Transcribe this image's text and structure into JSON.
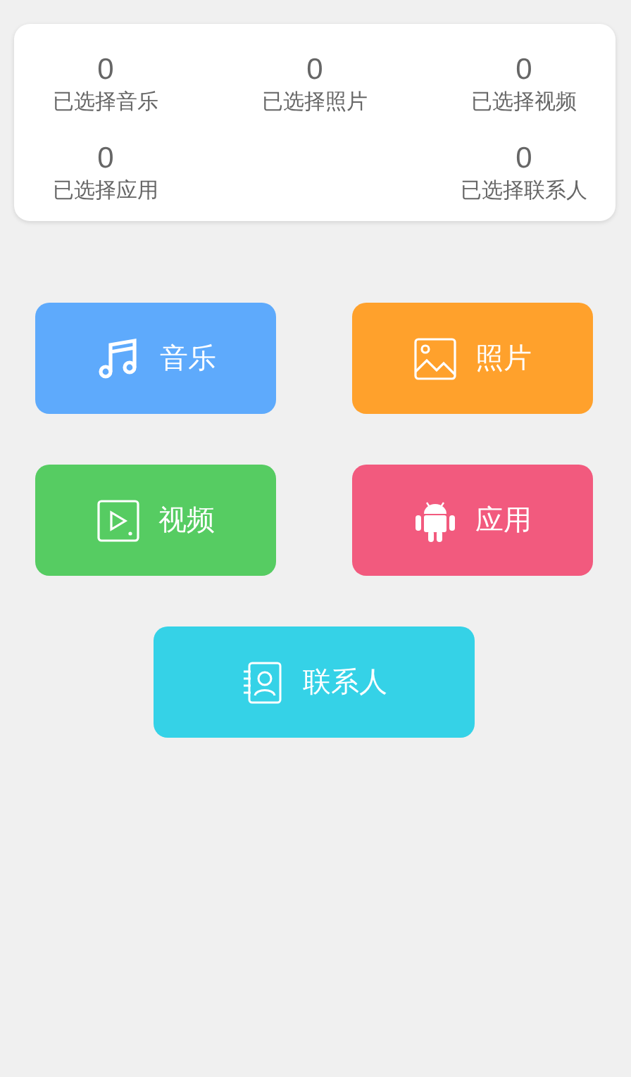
{
  "summary": {
    "rows": [
      [
        {
          "count": "0",
          "label": "已选择音乐"
        },
        {
          "count": "0",
          "label": "已选择照片"
        },
        {
          "count": "0",
          "label": "已选择视频"
        }
      ],
      [
        {
          "count": "0",
          "label": "已选择应用"
        },
        "",
        {
          "count": "0",
          "label": "已选择联系人"
        }
      ]
    ]
  },
  "categories": [
    {
      "label": "音乐",
      "kind": "music",
      "color": "#5eaafc"
    },
    {
      "label": "照片",
      "kind": "photo",
      "color": "#ffa12c"
    },
    {
      "label": "视频",
      "kind": "video",
      "color": "#56cc62"
    },
    {
      "label": "应用",
      "kind": "app",
      "color": "#f25a7e"
    },
    {
      "label": "联系人",
      "kind": "contacts",
      "color": "#35d2e7"
    }
  ]
}
